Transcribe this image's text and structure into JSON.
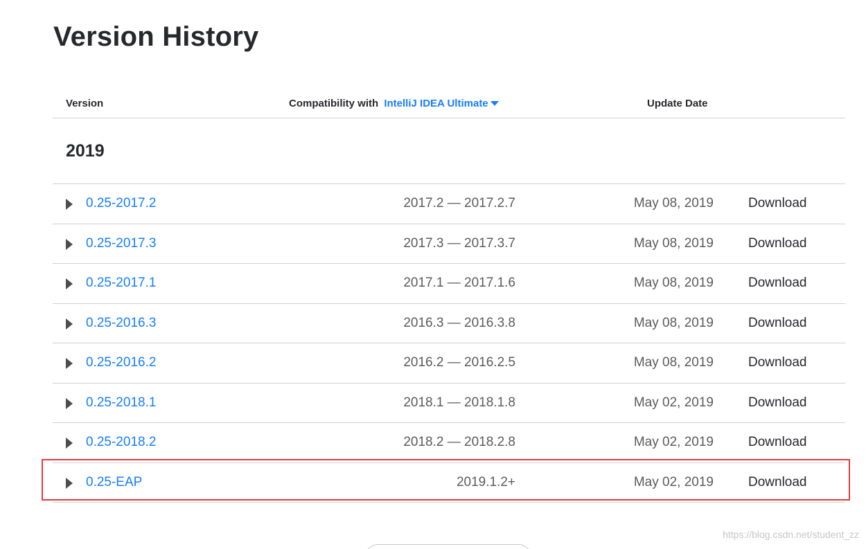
{
  "page": {
    "title": "Version History"
  },
  "table": {
    "headers": {
      "version": "Version",
      "compat_prefix": "Compatibility with",
      "compat_product": "IntelliJ IDEA Ultimate",
      "update_date": "Update Date"
    },
    "year": "2019",
    "rows": [
      {
        "version": "0.25-2017.2",
        "compat": "2017.2 — 2017.2.7",
        "date": "May 08, 2019",
        "action": "Download"
      },
      {
        "version": "0.25-2017.3",
        "compat": "2017.3 — 2017.3.7",
        "date": "May 08, 2019",
        "action": "Download"
      },
      {
        "version": "0.25-2017.1",
        "compat": "2017.1 — 2017.1.6",
        "date": "May 08, 2019",
        "action": "Download"
      },
      {
        "version": "0.25-2016.3",
        "compat": "2016.3 — 2016.3.8",
        "date": "May 08, 2019",
        "action": "Download"
      },
      {
        "version": "0.25-2016.2",
        "compat": "2016.2 — 2016.2.5",
        "date": "May 08, 2019",
        "action": "Download"
      },
      {
        "version": "0.25-2018.1",
        "compat": "2018.1 — 2018.1.8",
        "date": "May 02, 2019",
        "action": "Download"
      },
      {
        "version": "0.25-2018.2",
        "compat": "2018.2 — 2018.2.8",
        "date": "May 02, 2019",
        "action": "Download"
      },
      {
        "version": "0.25-EAP",
        "compat": "2019.1.2+",
        "date": "May 02, 2019",
        "action": "Download"
      }
    ]
  },
  "watermark": "https://blog.csdn.net/student_zz",
  "colors": {
    "link": "#167dff",
    "highlight": "#e4393c",
    "divider": "#d1d1d2"
  }
}
